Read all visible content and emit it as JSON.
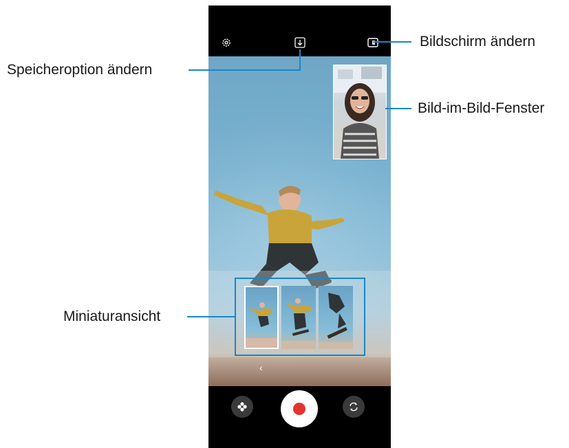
{
  "callouts": {
    "storage_option": "Speicheroption ändern",
    "change_screen": "Bildschirm ändern",
    "pip_window": "Bild-im-Bild-Fenster",
    "thumbnail_view": "Miniaturansicht"
  },
  "icons": {
    "settings": "gear-icon",
    "storage": "download-icon",
    "screen": "screen-layout-icon",
    "back": "chevron-left-icon",
    "effects": "flower-icon",
    "record": "record-icon",
    "switch": "switch-camera-icon"
  },
  "colors": {
    "accent": "#1787c7",
    "record": "#e3352d",
    "phone": "#000000"
  }
}
